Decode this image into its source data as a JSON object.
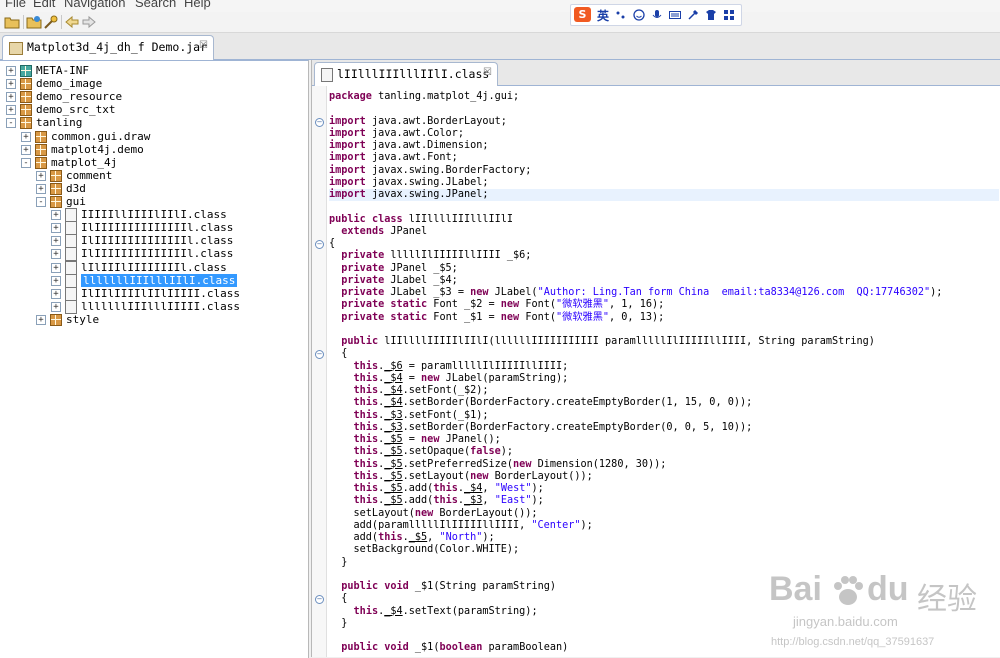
{
  "menubar": {
    "items": [
      "File",
      "Edit",
      "Navigation",
      "Search",
      "Help"
    ]
  },
  "ime": {
    "lang": "英",
    "icons": [
      "sogou-logo-icon",
      "punctuation-icon",
      "emoji-icon",
      "mic-icon",
      "keyboard-icon",
      "tools-icon",
      "skin-icon",
      "grid-icon"
    ]
  },
  "top_tab": {
    "label": "Matplot3d_4j_dh_f Demo.jar",
    "close": "☒"
  },
  "tree": {
    "rows": [
      {
        "label": "META-INF",
        "indent": 0,
        "toggle": "+",
        "icon": "folder"
      },
      {
        "label": "demo_image",
        "indent": 0,
        "toggle": "+",
        "icon": "package"
      },
      {
        "label": "demo_resource",
        "indent": 0,
        "toggle": "+",
        "icon": "package"
      },
      {
        "label": "demo_src_txt",
        "indent": 0,
        "toggle": "+",
        "icon": "package"
      },
      {
        "label": "tanling",
        "indent": 0,
        "toggle": "-",
        "icon": "package"
      },
      {
        "label": "common.gui.draw",
        "indent": 1,
        "toggle": "+",
        "icon": "package"
      },
      {
        "label": "matplot4j.demo",
        "indent": 1,
        "toggle": "+",
        "icon": "package"
      },
      {
        "label": "matplot_4j",
        "indent": 1,
        "toggle": "-",
        "icon": "package"
      },
      {
        "label": "comment",
        "indent": 2,
        "toggle": "+",
        "icon": "package"
      },
      {
        "label": "d3d",
        "indent": 2,
        "toggle": "+",
        "icon": "package"
      },
      {
        "label": "gui",
        "indent": 2,
        "toggle": "-",
        "icon": "package"
      },
      {
        "label": "IIIIIllIIIIlIIlI.class",
        "indent": 3,
        "toggle": "+",
        "icon": "class"
      },
      {
        "label": "IlIIIIIIIIIIIIIIl.class",
        "indent": 3,
        "toggle": "+",
        "icon": "class"
      },
      {
        "label": "IlIIIIIIIIIIIIIIl.class",
        "indent": 3,
        "toggle": "+",
        "icon": "class"
      },
      {
        "label": "IlIIIIIIIIIIIIIIl.class",
        "indent": 3,
        "toggle": "+",
        "icon": "class"
      },
      {
        "label": "lIlIIIlIIIIIIIIl.class",
        "indent": 3,
        "toggle": "+",
        "icon": "class"
      },
      {
        "label": "lllllllIIIlllIIlI.class",
        "indent": 3,
        "toggle": "+",
        "icon": "class",
        "selected": true
      },
      {
        "label": "IlIIlIIIIlIIlIIIII.class",
        "indent": 3,
        "toggle": "+",
        "icon": "class"
      },
      {
        "label": "lllllllIIIlllIIIII.class",
        "indent": 3,
        "toggle": "+",
        "icon": "class"
      },
      {
        "label": "style",
        "indent": 2,
        "toggle": "+",
        "icon": "package"
      }
    ]
  },
  "editor": {
    "tab_label": "lIIlllIIIlllIIlI.class",
    "close": "☒",
    "lines": [
      "package tanling.matplot_4j.gui;",
      "",
      "import java.awt.BorderLayout;",
      "import java.awt.Color;",
      "import java.awt.Dimension;",
      "import java.awt.Font;",
      "import javax.swing.BorderFactory;",
      "import javax.swing.JLabel;",
      "import javax.swing.JPanel;",
      "",
      "public class lIIllllIIIlllIIlI",
      "  extends JPanel",
      "{",
      "  private lllllIlIIIIIllIIII _$6;",
      "  private JPanel _$5;",
      "  private JLabel _$4;",
      "  private JLabel _$3 = new JLabel(\"Author: Ling.Tan form China  email:ta8334@126.com  QQ:17746302\");",
      "  private static Font _$2 = new Font(\"微软雅黑\", 1, 16);",
      "  private static Font _$1 = new Font(\"微软雅黑\", 0, 13);",
      "",
      "  public lIIllllIIIIIlIIlI(llllllIIIIIIIIIII paramlllllIlIIIIIllIIII, String paramString)",
      "  {",
      "    this._$6 = paramlllllIlIIIIIllIIII;",
      "    this._$4 = new JLabel(paramString);",
      "    this._$4.setFont(_$2);",
      "    this._$4.setBorder(BorderFactory.createEmptyBorder(1, 15, 0, 0));",
      "    this._$3.setFont(_$1);",
      "    this._$3.setBorder(BorderFactory.createEmptyBorder(0, 0, 5, 10));",
      "    this._$5 = new JPanel();",
      "    this._$5.setOpaque(false);",
      "    this._$5.setPreferredSize(new Dimension(1280, 30));",
      "    this._$5.setLayout(new BorderLayout());",
      "    this._$5.add(this._$4, \"West\");",
      "    this._$5.add(this._$3, \"East\");",
      "    setLayout(new BorderLayout());",
      "    add(paramlllllIlIIIIIllIIII, \"Center\");",
      "    add(this._$5, \"North\");",
      "    setBackground(Color.WHITE);",
      "  }",
      "",
      "  public void _$1(String paramString)",
      "  {",
      "    this._$4.setText(paramString);",
      "  }",
      "",
      "  public void _$1(boolean paramBoolean)"
    ]
  },
  "watermark": {
    "brand": "Bai",
    "brand2": "du",
    "cn": "经验",
    "url": "jingyan.baidu.com",
    "blog": "http://blog.csdn.net/qq_37591637"
  },
  "colors": {
    "keyword": "#7f0055",
    "string": "#2a00ff",
    "selection": "#3399ff",
    "line_highlight": "#e8f2fe"
  }
}
